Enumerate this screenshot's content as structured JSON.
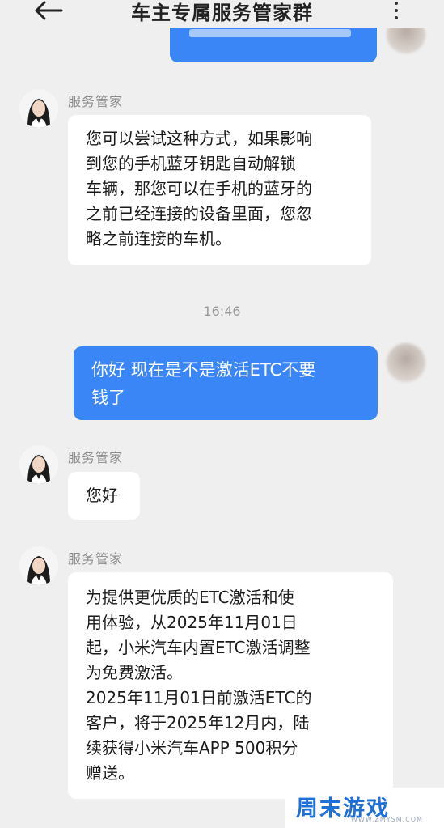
{
  "header": {
    "title": "车主专属服务管家群"
  },
  "messages": {
    "m0_out_text": "",
    "m1_sender": "服务管家",
    "m1_text": "您可以尝试这种方式，如果影响\n到您的手机蓝牙钥匙自动解锁\n车辆，那您可以在手机的蓝牙的\n之前已经连接的设备里面，您忽\n略之前连接的车机。",
    "timestamp": "16:46",
    "m2_out_text": "你好 现在是不是激活ETC不要\n钱了",
    "m3_sender": "服务管家",
    "m3_text": "您好",
    "m4_sender": "服务管家",
    "m4_text": "为提供更优质的ETC激活和使\n用体验，从2025年11月01日\n起，小米汽车内置ETC激活调整\n为免费激活。\n2025年11月01日前激活ETC的\n客户，将于2025年12月内，陆\n续获得小米汽车APP 500积分\n赠送。"
  },
  "watermark": {
    "main": "周末游戏",
    "sub": "WWW.ZMYSM.COM"
  },
  "colors": {
    "outgoing_bubble": "#3a86f7",
    "background": "#efefef",
    "incoming_bubble": "#ffffff"
  }
}
